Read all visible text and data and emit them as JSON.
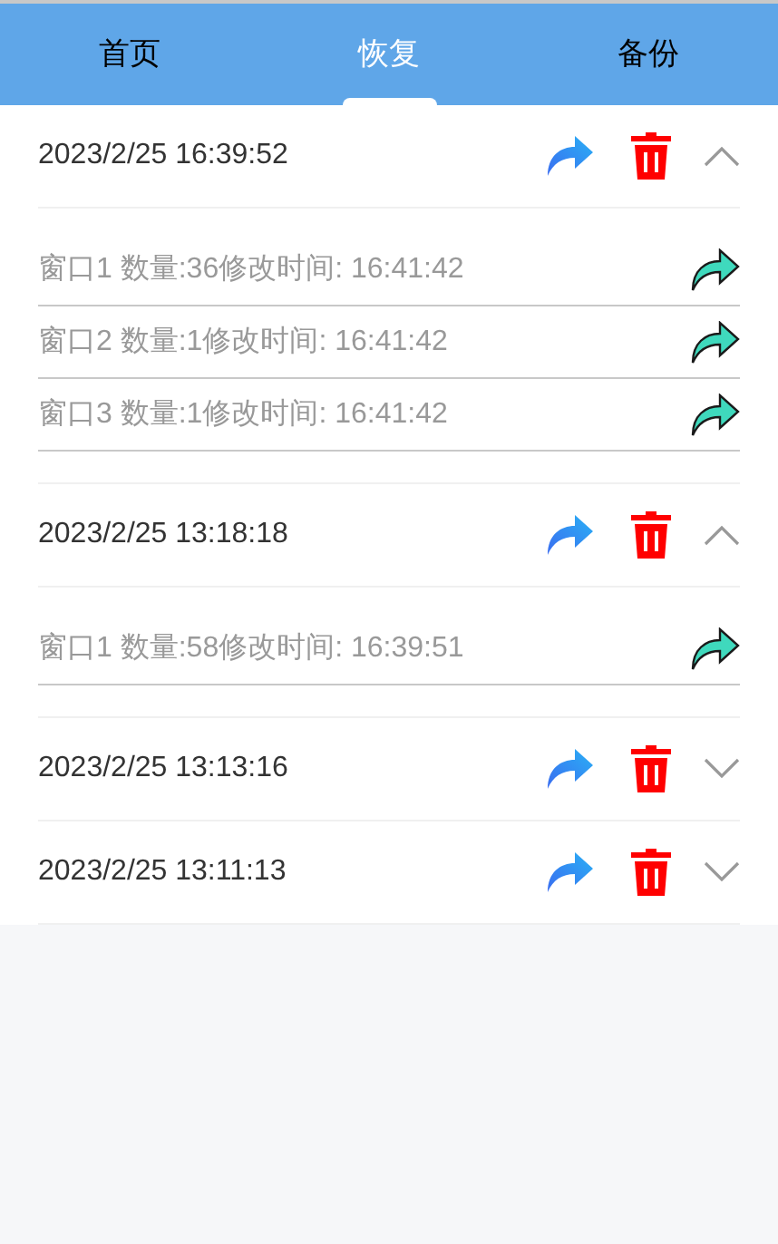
{
  "tabs": [
    {
      "label": "首页",
      "selected": false
    },
    {
      "label": "恢复",
      "selected": true
    },
    {
      "label": "备份",
      "selected": false
    }
  ],
  "backups": [
    {
      "time": "2023/2/25 16:39:52",
      "expanded": true,
      "windows": [
        {
          "text": "窗口1 数量:36修改时间: 16:41:42"
        },
        {
          "text": "窗口2 数量:1修改时间: 16:41:42"
        },
        {
          "text": "窗口3 数量:1修改时间: 16:41:42"
        }
      ]
    },
    {
      "time": "2023/2/25 13:18:18",
      "expanded": true,
      "windows": [
        {
          "text": "窗口1 数量:58修改时间: 16:39:51"
        }
      ]
    },
    {
      "time": "2023/2/25 13:13:16",
      "expanded": false
    },
    {
      "time": "2023/2/25 13:11:13",
      "expanded": false
    }
  ]
}
